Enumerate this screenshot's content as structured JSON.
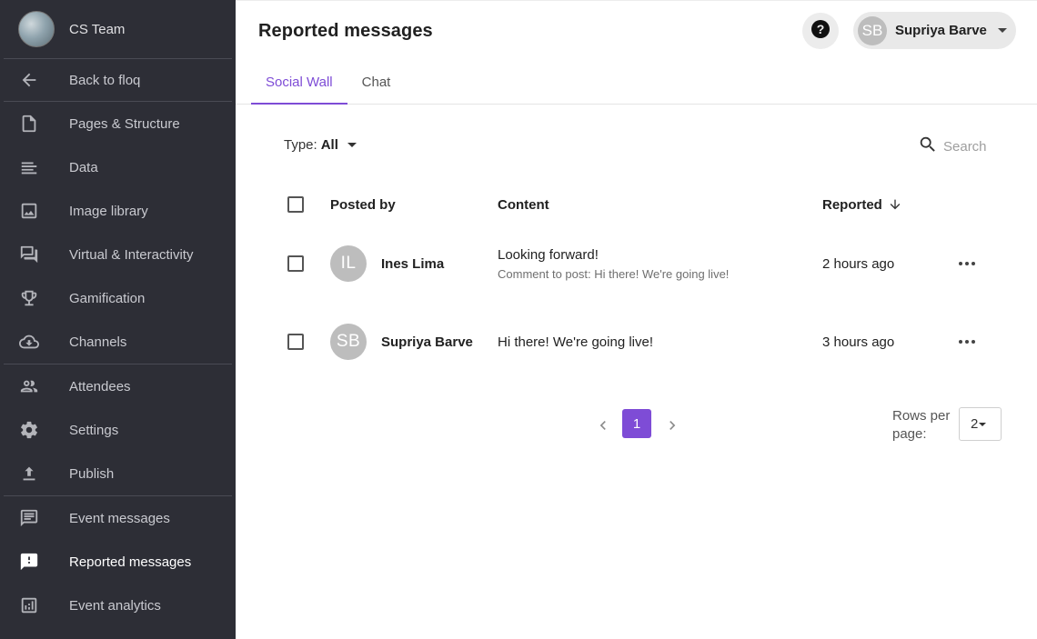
{
  "sidebar": {
    "team_name": "CS Team",
    "team_logo_icon": "event-logo",
    "back_label": "Back to floq",
    "items": [
      {
        "label": "Pages & Structure",
        "icon": "page-icon"
      },
      {
        "label": "Data",
        "icon": "list-lines-icon"
      },
      {
        "label": "Image library",
        "icon": "image-icon"
      },
      {
        "label": "Virtual & Interactivity",
        "icon": "chat-bubbles-icon"
      },
      {
        "label": "Gamification",
        "icon": "trophy-icon"
      },
      {
        "label": "Channels",
        "icon": "cloud-download-icon"
      },
      {
        "label": "Attendees",
        "icon": "people-icon"
      },
      {
        "label": "Settings",
        "icon": "gear-icon"
      },
      {
        "label": "Publish",
        "icon": "upload-icon"
      },
      {
        "label": "Event messages",
        "icon": "message-icon"
      },
      {
        "label": "Reported messages",
        "icon": "report-message-icon",
        "active": true
      },
      {
        "label": "Event analytics",
        "icon": "analytics-icon"
      }
    ]
  },
  "header": {
    "title": "Reported messages",
    "user": {
      "initials": "SB",
      "name": "Supriya Barve"
    }
  },
  "tabs": [
    {
      "label": "Social Wall",
      "active": true
    },
    {
      "label": "Chat",
      "active": false
    }
  ],
  "filters": {
    "type_label": "Type:",
    "type_value": "All",
    "search_placeholder": "Search"
  },
  "table": {
    "columns": {
      "posted_by": "Posted by",
      "content": "Content",
      "reported": "Reported"
    },
    "sort": {
      "column": "Reported",
      "direction": "descending"
    },
    "rows": [
      {
        "initials": "IL",
        "name": "Ines Lima",
        "content": "Looking forward!",
        "sub": "Comment to post: Hi there! We're going live!",
        "reported": "2 hours ago"
      },
      {
        "initials": "SB",
        "name": "Supriya Barve",
        "content": "Hi there! We're going live!",
        "sub": "",
        "reported": "3 hours ago"
      }
    ]
  },
  "pagination": {
    "current_page": "1",
    "rows_per_page_label": "Rows per page:",
    "rows_per_page_value": "2"
  },
  "colors": {
    "accent": "#7e4cd6",
    "sidebar_bg": "#2d2e36",
    "avatar_bg": "#bdbdbd"
  }
}
